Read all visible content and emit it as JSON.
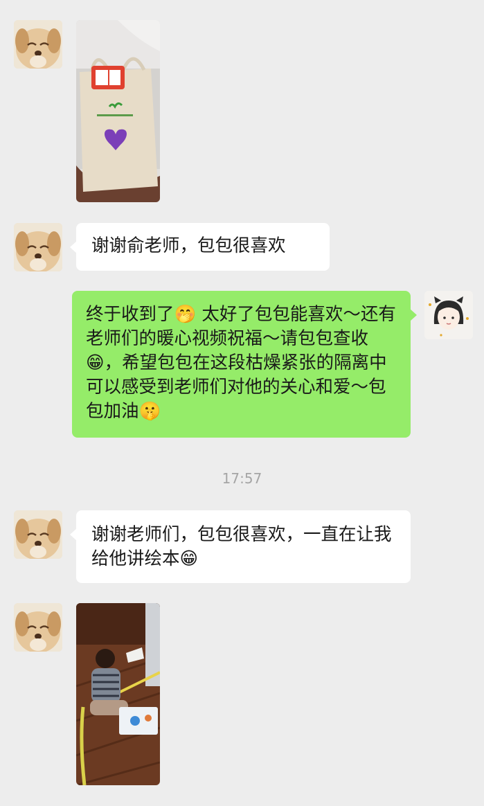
{
  "messages": {
    "m2": {
      "text": "谢谢俞老师，包包很喜欢"
    },
    "m3": {
      "text": "终于收到了🤭 太好了包包能喜欢～还有老师们的暖心视频祝福～请包包查收😁，希望包包在这段枯燥紧张的隔离中可以感受到老师们对他的关心和爱～包包加油🤫"
    },
    "timestamp": "17:57",
    "m4": {
      "text": "谢谢老师们，包包很喜欢，一直在让我给他讲绘本😁"
    }
  },
  "colors": {
    "background": "#ededed",
    "bubble_self": "#95ec69",
    "bubble_other": "#ffffff",
    "timestamp": "#a5a5a5"
  }
}
